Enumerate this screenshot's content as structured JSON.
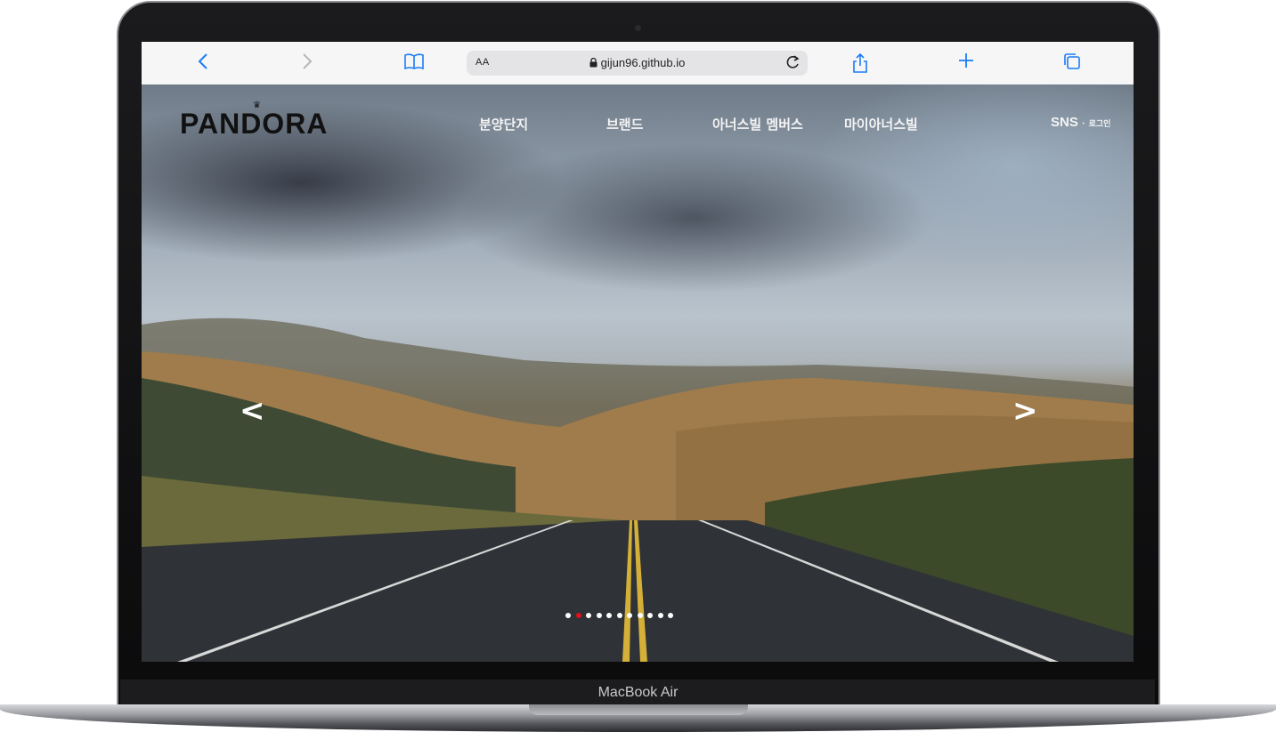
{
  "device": {
    "model_label": "MacBook Air"
  },
  "browser": {
    "back_icon": "chevron-left-icon",
    "forward_icon": "chevron-right-icon",
    "bookmarks_icon": "book-icon",
    "text_size_label": "AA",
    "url": "gijun96.github.io",
    "reload_icon": "reload-icon",
    "share_icon": "share-icon",
    "new_tab_icon": "plus-icon",
    "tabs_icon": "tabs-icon",
    "accent_color": "#1a7cf5"
  },
  "site": {
    "logo": "PANDORA",
    "nav": [
      "분양단지",
      "브랜드",
      "아너스빌 멤버스",
      "마이아너스빌"
    ],
    "sns_label": "SNS",
    "separator": "·",
    "login_label": "로그인",
    "slider": {
      "prev_label": "<",
      "next_label": ">",
      "dot_count": 11,
      "active_index": 1,
      "active_color": "#e3101a"
    }
  }
}
